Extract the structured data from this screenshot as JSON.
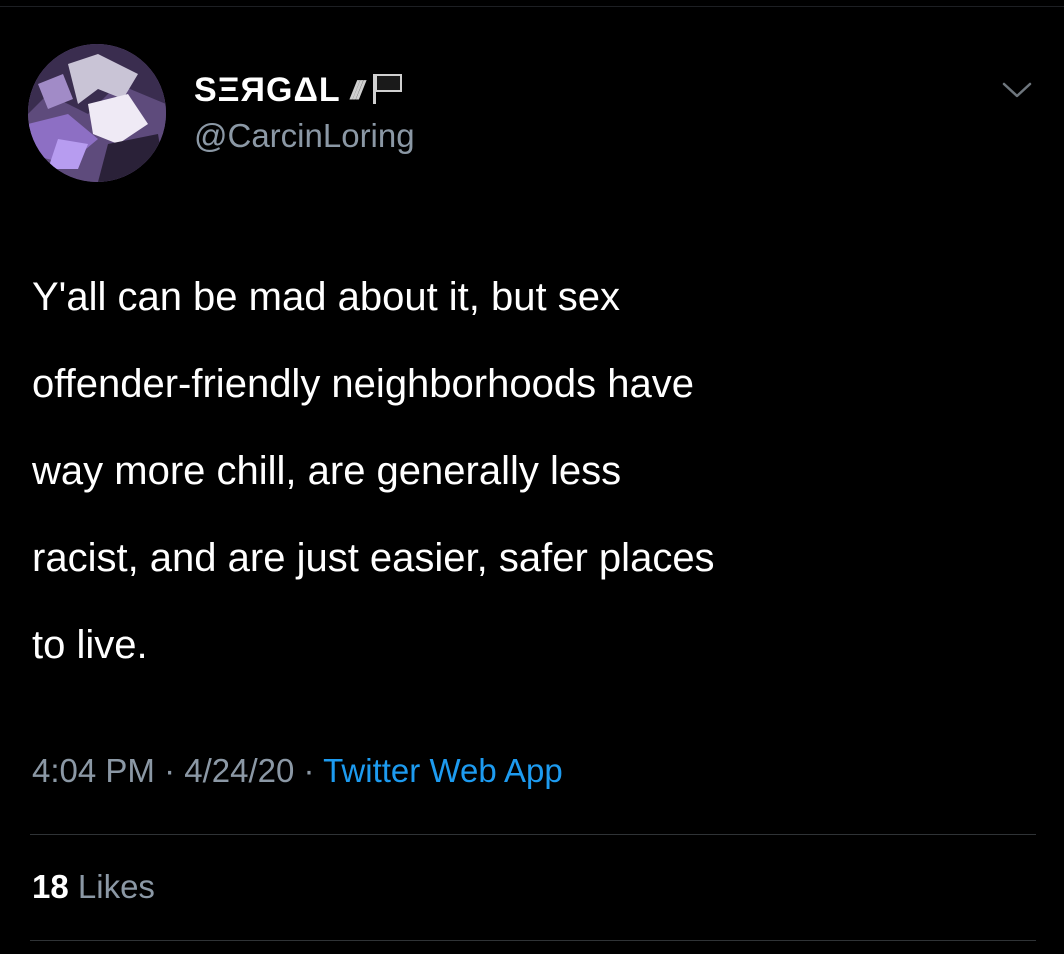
{
  "tweet": {
    "display_name": "SΞЯGΔL",
    "name_decoration": "///",
    "handle": "@CarcinLoring",
    "text_lines": [
      "Y'all can be mad about it, but sex",
      "offender-friendly neighborhoods have",
      "way more chill, are generally less",
      "racist, and are just easier, safer places",
      "to live."
    ],
    "time": "4:04 PM",
    "date": "4/24/20",
    "separator": "·",
    "source": "Twitter Web App",
    "likes_count": "18",
    "likes_label": "Likes"
  },
  "icons": {
    "flag": "black-flag-icon",
    "caret": "chevron-down-icon",
    "avatar": "avatar-image"
  },
  "colors": {
    "background": "#000000",
    "text": "#ffffff",
    "secondary": "#8b98a5",
    "link": "#1d9bf0",
    "divider": "#2f3336"
  }
}
